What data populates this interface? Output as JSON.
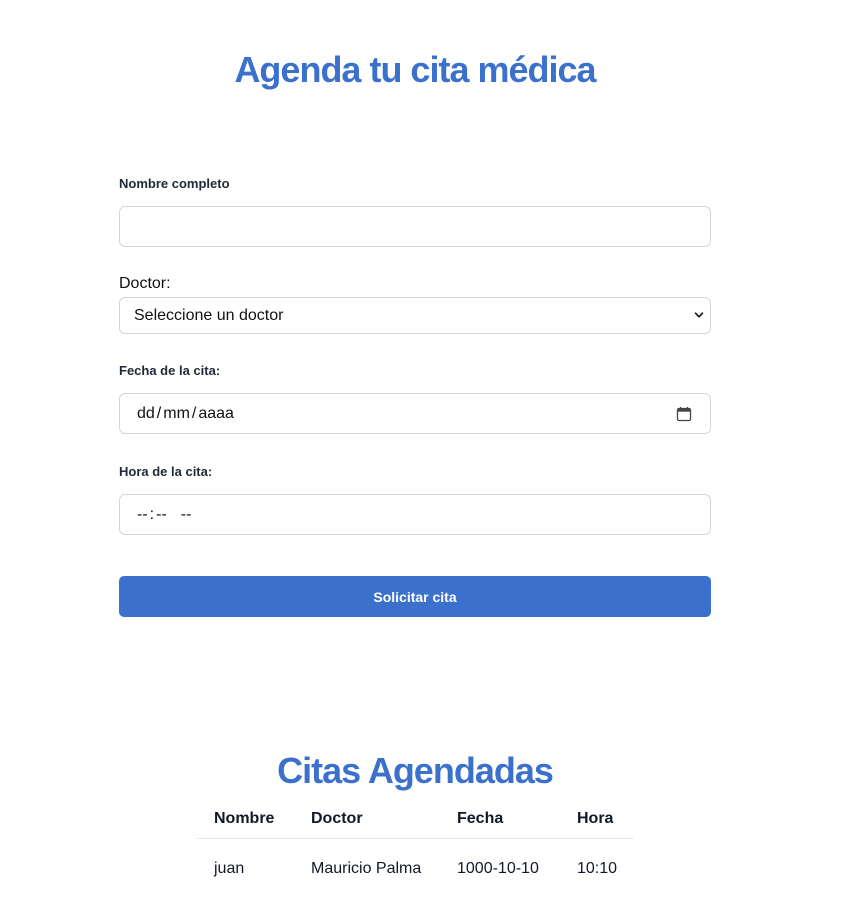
{
  "form": {
    "title": "Agenda tu cita médica",
    "name_label": "Nombre completo",
    "name_value": "",
    "doctor_label": "Doctor:",
    "doctor_selected": "Seleccione un doctor",
    "date_label": "Fecha de la cita:",
    "date_placeholder": {
      "day": "dd",
      "sep1": "/",
      "month": "mm",
      "sep2": "/",
      "year": "aaaa"
    },
    "time_label": "Hora de la cita:",
    "time_placeholder": {
      "hour": "--",
      "sep": ":",
      "minute": "--",
      "ampm": "--"
    },
    "submit_label": "Solicitar cita"
  },
  "appointments": {
    "title": "Citas Agendadas",
    "headers": [
      "Nombre",
      "Doctor",
      "Fecha",
      "Hora"
    ],
    "rows": [
      [
        "juan",
        "Mauricio Palma",
        "1000-10-10",
        "10:10"
      ]
    ]
  },
  "colors": {
    "accent": "#3b71cc",
    "border": "#d1d5db"
  },
  "icons": {
    "select": "chevron-down-icon",
    "date": "calendar-icon"
  }
}
